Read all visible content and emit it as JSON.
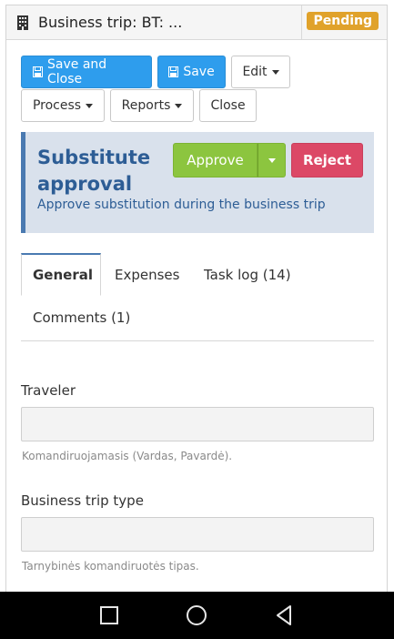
{
  "header": {
    "title": "Business trip: BT: ...",
    "status_badge": "Pending",
    "status_color": "#e0a22b",
    "icon": "building-icon"
  },
  "toolbar": {
    "save_and_close": "Save and Close",
    "save": "Save",
    "edit": "Edit",
    "process": "Process",
    "reports": "Reports",
    "close": "Close"
  },
  "approval": {
    "title": "Substitute approval",
    "description": "Approve substitution during the business trip",
    "approve_label": "Approve",
    "reject_label": "Reject",
    "approve_color": "#8cc53f",
    "reject_color": "#dc4866"
  },
  "tabs": [
    {
      "label": "General",
      "active": true
    },
    {
      "label": "Expenses",
      "active": false
    },
    {
      "label": "Task log (14)",
      "active": false
    },
    {
      "label": "Comments (1)",
      "active": false
    }
  ],
  "fields": [
    {
      "label": "Traveler",
      "value": "",
      "help": "Komandiruojamasis (Vardas, Pavardė)."
    },
    {
      "label": "Business trip type",
      "value": "",
      "help": "Tarnybinės komandiruotės tipas."
    }
  ],
  "android_nav": [
    "recents-icon",
    "home-icon",
    "back-icon"
  ]
}
